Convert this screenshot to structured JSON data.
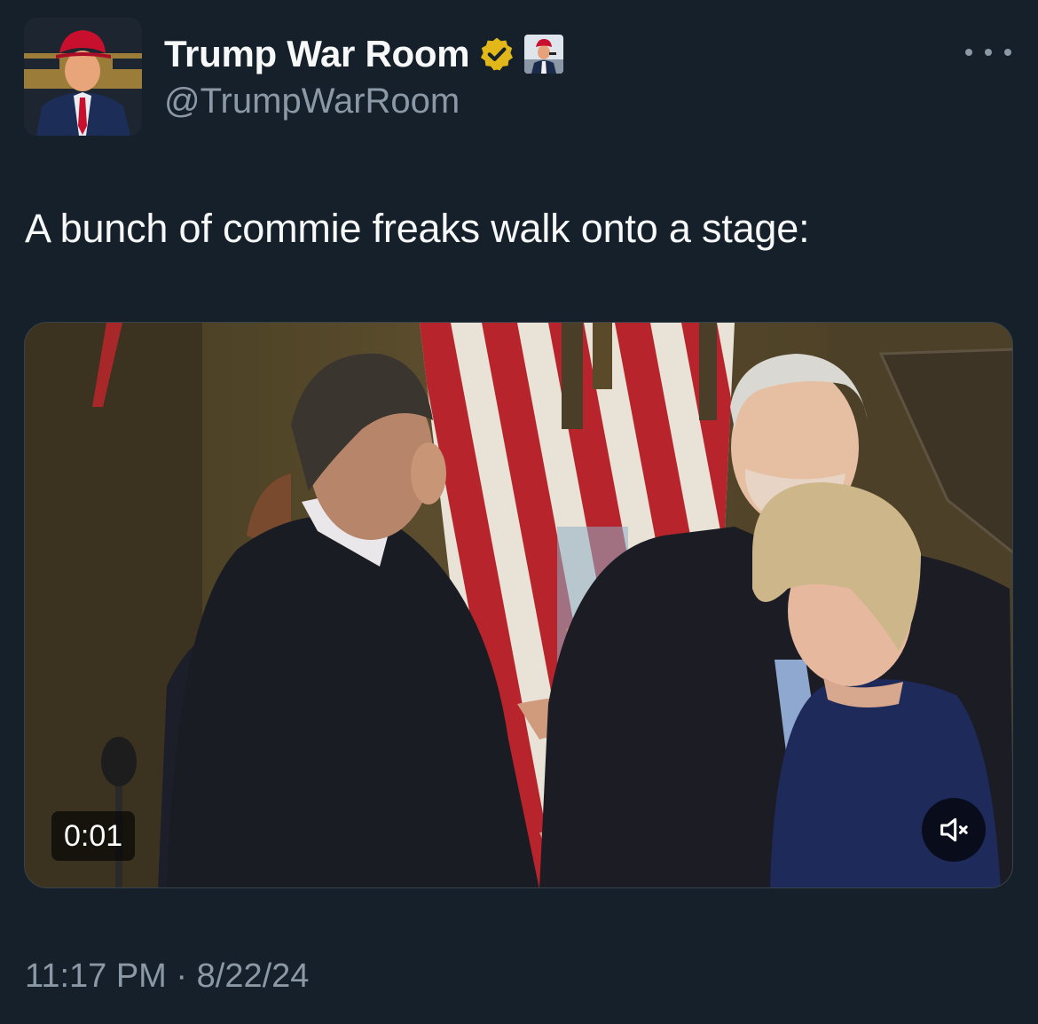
{
  "tweet": {
    "author": {
      "display_name": "Trump War Room",
      "handle": "@TrumpWarRoom",
      "avatar_icon": "trump-portrait-avatar",
      "verified_badge_icon": "gold-verified-badge-icon",
      "verified_color": "#e2b719",
      "affiliate_badge_icon": "affiliate-trump-portrait-icon"
    },
    "more_icon": "more-horizontal-icon",
    "text": "A bunch of commie freaks walk onto a stage:",
    "media": {
      "type": "video",
      "elapsed": "0:01",
      "mute_icon": "volume-muted-icon"
    },
    "time": "11:17 PM",
    "separator": "·",
    "date": "8/22/24"
  },
  "colors": {
    "background": "#15202b",
    "primary_text": "#f7f9f9",
    "secondary_text": "#8b98a5",
    "border": "#38444d"
  }
}
